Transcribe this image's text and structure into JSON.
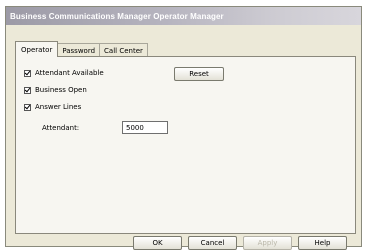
{
  "window": {
    "title": "Business Communications Manager Operator Manager"
  },
  "tabs": [
    {
      "label": "Operator",
      "active": true
    },
    {
      "label": "Password",
      "active": false
    },
    {
      "label": "Call Center",
      "active": false
    }
  ],
  "operator": {
    "attendant_available": {
      "label": "Attendant Available",
      "checked": true
    },
    "business_open": {
      "label": "Business Open",
      "checked": true
    },
    "answer_lines": {
      "label": "Answer Lines",
      "checked": true
    },
    "attendant": {
      "label": "Attendant:",
      "value": "5000"
    },
    "reset_label": "Reset"
  },
  "footer": {
    "ok_label": "OK",
    "cancel_label": "Cancel",
    "apply_label": "Apply",
    "help_label": "Help"
  }
}
